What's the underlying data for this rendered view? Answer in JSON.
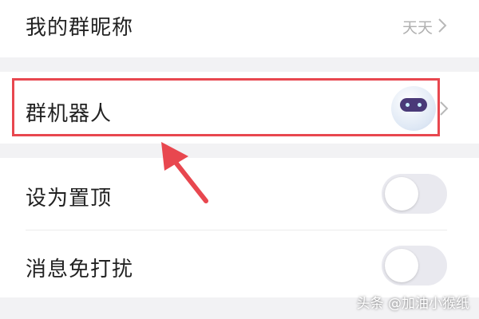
{
  "group_nickname": {
    "label": "我的群昵称",
    "value": "天天"
  },
  "group_robot": {
    "label": "群机器人",
    "avatar_icon": "robot-avatar"
  },
  "pin_top": {
    "label": "设为置顶",
    "enabled": false
  },
  "mute": {
    "label": "消息免打扰",
    "enabled": false
  },
  "watermark": "头条 @加油小猴纸",
  "colors": {
    "highlight": "#e8474f",
    "arrow": "#e8474f",
    "separator": "#f2f2f4",
    "toggle_off": "#e9e9ef"
  }
}
